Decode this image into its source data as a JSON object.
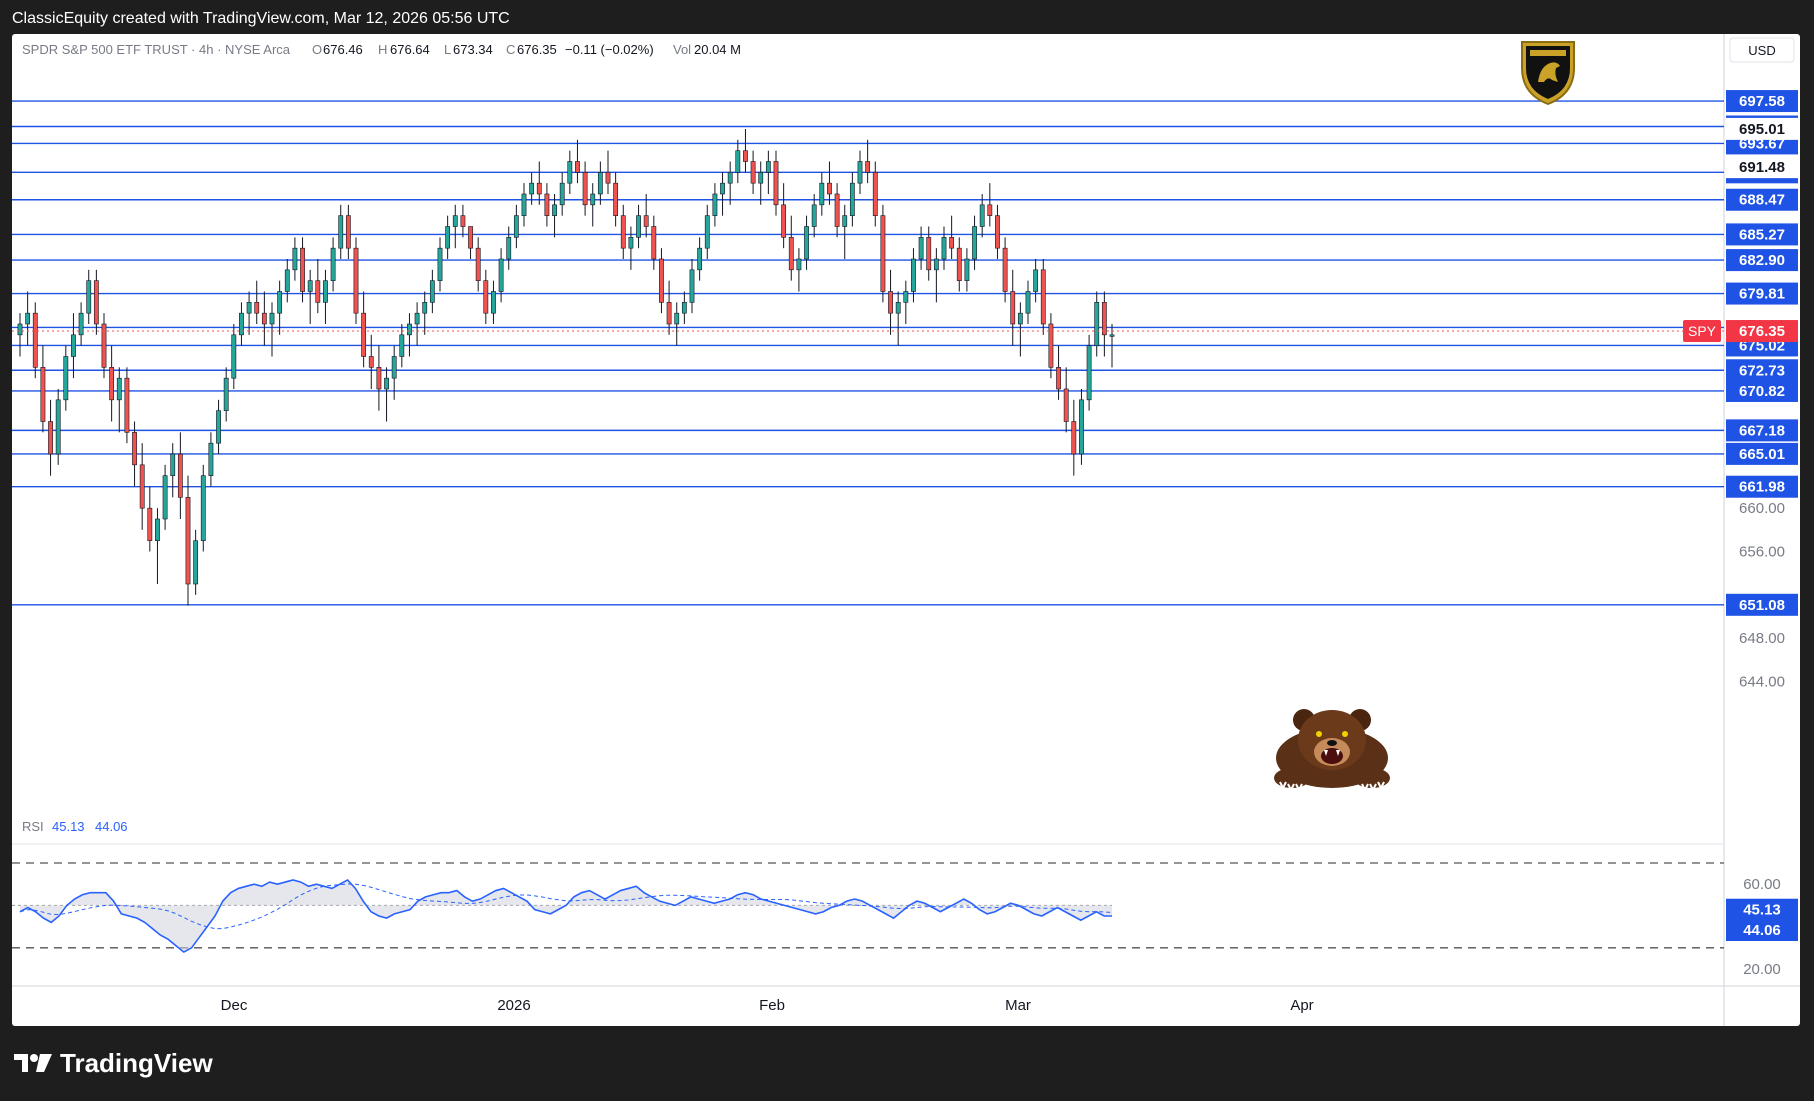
{
  "header": {
    "caption": "ClassicEquity created with TradingView.com, Mar 12, 2026 05:56 UTC"
  },
  "footer": {
    "brand": "TradingView",
    "logo_icon": "tradingview-logo-icon"
  },
  "legend": {
    "symbol_line": "SPDR S&P 500 ETF TRUST · 4h · NYSE Arca",
    "open_label": "O",
    "open": "676.46",
    "high_label": "H",
    "high": "676.64",
    "low_label": "L",
    "low": "673.34",
    "close_label": "C",
    "close": "676.35",
    "change": "−0.11 (−0.02%)",
    "vol_label": "Vol",
    "vol": "20.04 M"
  },
  "currency": "USD",
  "ticker_badge": "SPY",
  "rsi_legend": {
    "label": "RSI",
    "v1": "45.13",
    "v2": "44.06"
  },
  "colors": {
    "up": "#26a69a",
    "down": "#ef5350",
    "level_line": "#1e53e5",
    "badge_bg": "#1e53e5",
    "spy_badge": "#f23645",
    "rsi_line": "#2962ff",
    "rsi_ma": "#2962ff"
  },
  "icons": [
    "lamborghini-logo-icon",
    "bear-icon",
    "tradingview-logo-icon"
  ],
  "chart_data": {
    "type": "candlestick",
    "title": "SPDR S&P 500 ETF TRUST · 4h · NYSE Arca",
    "ylim": [
      641,
      701
    ],
    "x_ticks": [
      "Dec",
      "2026",
      "Feb",
      "Mar",
      "Apr"
    ],
    "levels_blue": [
      "697.58",
      "695.23",
      "693.67",
      "691.00",
      "688.47",
      "685.27",
      "682.90",
      "679.81",
      "676.68",
      "675.02",
      "672.73",
      "670.82",
      "667.18",
      "665.01",
      "661.98",
      "651.08"
    ],
    "levels_plain": [
      "695.01",
      "691.48",
      "676.93"
    ],
    "price_scale_ticks": [
      "660.00",
      "656.00",
      "648.00",
      "644.00"
    ],
    "last_price": "676.35",
    "last_price_value": 676.35,
    "level_values": [
      697.58,
      695.23,
      693.67,
      691.0,
      688.47,
      685.27,
      682.9,
      679.81,
      676.68,
      675.02,
      672.73,
      670.82,
      667.18,
      665.01,
      661.98,
      651.08
    ],
    "series": [
      {
        "name": "SPY",
        "ohlc": [
          [
            676,
            678,
            674,
            677
          ],
          [
            677,
            680,
            675,
            678
          ],
          [
            678,
            679,
            672,
            673
          ],
          [
            673,
            675,
            667,
            668
          ],
          [
            668,
            670,
            663,
            665
          ],
          [
            665,
            671,
            664,
            670
          ],
          [
            670,
            675,
            669,
            674
          ],
          [
            674,
            678,
            672,
            676
          ],
          [
            676,
            679,
            675,
            678
          ],
          [
            678,
            682,
            677,
            681
          ],
          [
            681,
            682,
            676,
            677
          ],
          [
            677,
            678,
            672,
            673
          ],
          [
            673,
            675,
            668,
            670
          ],
          [
            670,
            673,
            667,
            672
          ],
          [
            672,
            673,
            666,
            667
          ],
          [
            667,
            668,
            662,
            664
          ],
          [
            664,
            666,
            658,
            660
          ],
          [
            660,
            662,
            656,
            657
          ],
          [
            657,
            660,
            653,
            659
          ],
          [
            659,
            664,
            658,
            663
          ],
          [
            663,
            666,
            661,
            665
          ],
          [
            665,
            667,
            659,
            661
          ],
          [
            661,
            663,
            651,
            653
          ],
          [
            653,
            658,
            652,
            657
          ],
          [
            657,
            664,
            656,
            663
          ],
          [
            663,
            667,
            662,
            666
          ],
          [
            666,
            670,
            665,
            669
          ],
          [
            669,
            673,
            668,
            672
          ],
          [
            672,
            677,
            671,
            676
          ],
          [
            676,
            679,
            675,
            678
          ],
          [
            678,
            680,
            676,
            679
          ],
          [
            679,
            681,
            677,
            678
          ],
          [
            678,
            680,
            675,
            677
          ],
          [
            677,
            679,
            674,
            678
          ],
          [
            678,
            681,
            676,
            680
          ],
          [
            680,
            683,
            679,
            682
          ],
          [
            682,
            685,
            681,
            684
          ],
          [
            684,
            685,
            679,
            680
          ],
          [
            680,
            682,
            677,
            681
          ],
          [
            681,
            683,
            678,
            679
          ],
          [
            679,
            682,
            677,
            681
          ],
          [
            681,
            685,
            680,
            684
          ],
          [
            684,
            688,
            683,
            687
          ],
          [
            687,
            688,
            683,
            684
          ],
          [
            684,
            685,
            677,
            678
          ],
          [
            678,
            680,
            673,
            674
          ],
          [
            674,
            676,
            671,
            673
          ],
          [
            673,
            675,
            669,
            671
          ],
          [
            671,
            673,
            668,
            672
          ],
          [
            672,
            675,
            670,
            674
          ],
          [
            674,
            677,
            673,
            676
          ],
          [
            676,
            678,
            674,
            677
          ],
          [
            677,
            679,
            675,
            678
          ],
          [
            678,
            680,
            676,
            679
          ],
          [
            679,
            682,
            678,
            681
          ],
          [
            681,
            685,
            680,
            684
          ],
          [
            684,
            687,
            683,
            686
          ],
          [
            686,
            688,
            684,
            687
          ],
          [
            687,
            688,
            685,
            686
          ],
          [
            686,
            686,
            683,
            684
          ],
          [
            684,
            685,
            680,
            681
          ],
          [
            681,
            682,
            677,
            678
          ],
          [
            678,
            681,
            677,
            680
          ],
          [
            680,
            684,
            679,
            683
          ],
          [
            683,
            686,
            682,
            685
          ],
          [
            685,
            688,
            684,
            687
          ],
          [
            687,
            690,
            686,
            689
          ],
          [
            689,
            691,
            688,
            690
          ],
          [
            690,
            692,
            688,
            689
          ],
          [
            689,
            690,
            686,
            687
          ],
          [
            687,
            689,
            685,
            688
          ],
          [
            688,
            691,
            687,
            690
          ],
          [
            690,
            693,
            689,
            692
          ],
          [
            692,
            694,
            690,
            691
          ],
          [
            691,
            692,
            687,
            688
          ],
          [
            688,
            690,
            686,
            689
          ],
          [
            689,
            692,
            688,
            691
          ],
          [
            691,
            693,
            689,
            690
          ],
          [
            690,
            691,
            686,
            687
          ],
          [
            687,
            688,
            683,
            684
          ],
          [
            684,
            686,
            682,
            685
          ],
          [
            685,
            688,
            684,
            687
          ],
          [
            687,
            689,
            685,
            686
          ],
          [
            686,
            687,
            682,
            683
          ],
          [
            683,
            684,
            678,
            679
          ],
          [
            679,
            681,
            676,
            677
          ],
          [
            677,
            679,
            675,
            678
          ],
          [
            678,
            680,
            677,
            679
          ],
          [
            679,
            683,
            678,
            682
          ],
          [
            682,
            685,
            681,
            684
          ],
          [
            684,
            688,
            683,
            687
          ],
          [
            687,
            690,
            686,
            689
          ],
          [
            689,
            691,
            687,
            690
          ],
          [
            690,
            692,
            688,
            691
          ],
          [
            691,
            694,
            690,
            693
          ],
          [
            693,
            695,
            691,
            692
          ],
          [
            692,
            693,
            689,
            690
          ],
          [
            690,
            692,
            688,
            691
          ],
          [
            691,
            693,
            689,
            692
          ],
          [
            692,
            693,
            687,
            688
          ],
          [
            688,
            690,
            684,
            685
          ],
          [
            685,
            687,
            681,
            682
          ],
          [
            682,
            684,
            680,
            683
          ],
          [
            683,
            687,
            682,
            686
          ],
          [
            686,
            689,
            685,
            688
          ],
          [
            688,
            691,
            687,
            690
          ],
          [
            690,
            692,
            688,
            689
          ],
          [
            689,
            690,
            685,
            686
          ],
          [
            686,
            688,
            683,
            687
          ],
          [
            687,
            691,
            686,
            690
          ],
          [
            690,
            693,
            689,
            692
          ],
          [
            692,
            694,
            690,
            691
          ],
          [
            691,
            692,
            686,
            687
          ],
          [
            687,
            688,
            679,
            680
          ],
          [
            680,
            682,
            676,
            678
          ],
          [
            678,
            680,
            675,
            679
          ],
          [
            679,
            681,
            677,
            680
          ],
          [
            680,
            684,
            679,
            683
          ],
          [
            683,
            686,
            682,
            685
          ],
          [
            685,
            686,
            681,
            682
          ],
          [
            682,
            684,
            679,
            683
          ],
          [
            683,
            686,
            682,
            685
          ],
          [
            685,
            687,
            683,
            684
          ],
          [
            684,
            685,
            680,
            681
          ],
          [
            681,
            684,
            680,
            683
          ],
          [
            683,
            687,
            682,
            686
          ],
          [
            686,
            689,
            685,
            688
          ],
          [
            688,
            690,
            686,
            687
          ],
          [
            687,
            688,
            683,
            684
          ],
          [
            684,
            685,
            679,
            680
          ],
          [
            680,
            682,
            675,
            677
          ],
          [
            677,
            679,
            674,
            678
          ],
          [
            678,
            681,
            677,
            680
          ],
          [
            680,
            683,
            679,
            682
          ],
          [
            682,
            683,
            676,
            677
          ],
          [
            677,
            678,
            672,
            673
          ],
          [
            673,
            675,
            670,
            671
          ],
          [
            671,
            673,
            667,
            668
          ],
          [
            668,
            670,
            663,
            665
          ],
          [
            665,
            671,
            664,
            670
          ],
          [
            670,
            676,
            669,
            675
          ],
          [
            675,
            680,
            674,
            679
          ],
          [
            679,
            680,
            674,
            676
          ],
          [
            676,
            677,
            673,
            676
          ]
        ]
      }
    ],
    "rsi": {
      "label": "RSI",
      "value": 45.13,
      "ma_value": 44.06,
      "upper": 70,
      "lower": 30,
      "mid": 50,
      "ticks": [
        "60.00",
        "20.00"
      ],
      "values": [
        47,
        49,
        47,
        44,
        42,
        45,
        50,
        53,
        55,
        56,
        56,
        56,
        52,
        46,
        45,
        44,
        42,
        39,
        36,
        34,
        31,
        28,
        30,
        35,
        40,
        45,
        52,
        56,
        58,
        59,
        60,
        59,
        61,
        60,
        61,
        62,
        61,
        59,
        60,
        59,
        58,
        60,
        62,
        58,
        52,
        47,
        45,
        44,
        46,
        47,
        48,
        52,
        54,
        55,
        56,
        56,
        57,
        54,
        52,
        53,
        55,
        57,
        58,
        56,
        54,
        52,
        48,
        47,
        46,
        48,
        50,
        54,
        56,
        57,
        55,
        53,
        55,
        57,
        58,
        59,
        56,
        54,
        52,
        51,
        50,
        52,
        54,
        53,
        52,
        51,
        52,
        53,
        55,
        56,
        55,
        53,
        52,
        51,
        50,
        49,
        48,
        47,
        46,
        47,
        49,
        50,
        52,
        53,
        52,
        50,
        48,
        46,
        44,
        47,
        50,
        52,
        51,
        49,
        47,
        49,
        51,
        53,
        51,
        48,
        46,
        47,
        49,
        51,
        50,
        48,
        46,
        45,
        47,
        49,
        47,
        45,
        43,
        45,
        47,
        45,
        45
      ]
    }
  }
}
